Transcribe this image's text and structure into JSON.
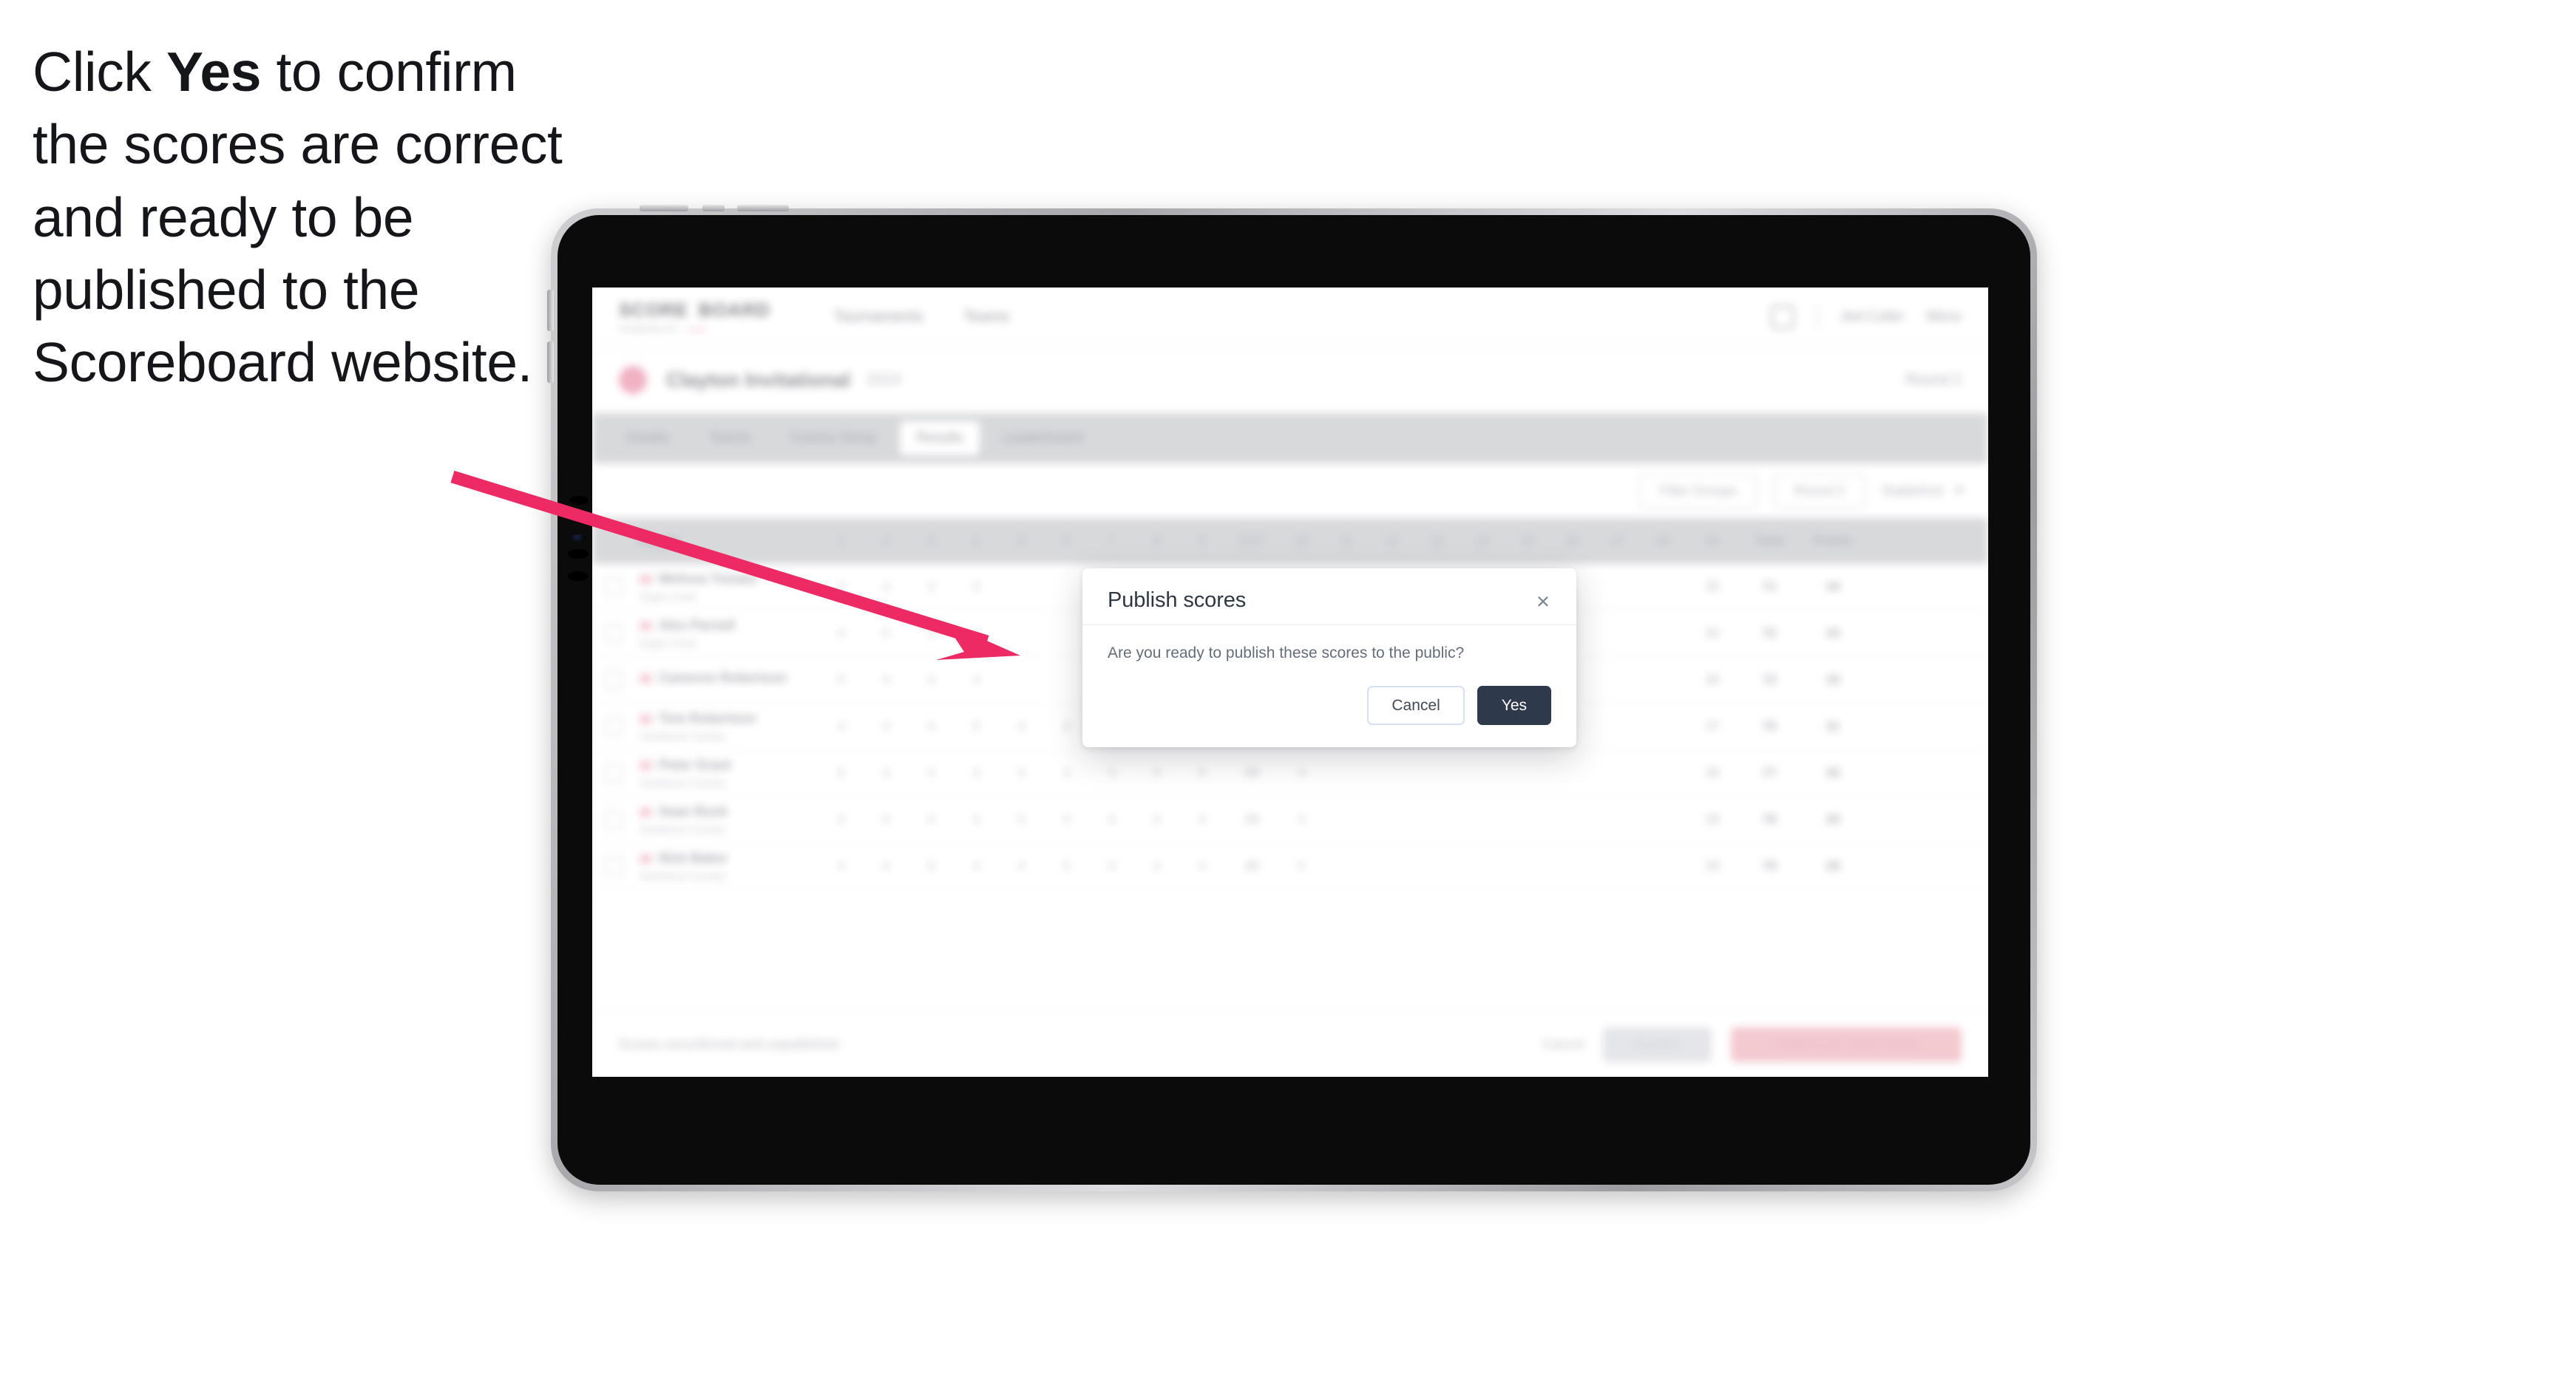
{
  "instruction": {
    "before": "Click ",
    "keyword": "Yes",
    "after": " to confirm the scores are correct and ready to be published to the Scoreboard website."
  },
  "colors": {
    "accent_pink": "#ED2A63",
    "modal_primary": "#2e3a4c",
    "device_frame": "#0b0b0c"
  },
  "annotation": {
    "arrow_name": "pointer-arrow",
    "points_to": "Yes"
  },
  "modal": {
    "title": "Publish scores",
    "close_glyph": "×",
    "message": "Are you ready to publish these scores to the public?",
    "cancel_label": "Cancel",
    "confirm_label": "Yes"
  },
  "app": {
    "brand": {
      "word1": "SCORE",
      "word2": "BOARD",
      "sub": "POWERED BY",
      "chip": ""
    },
    "topnav": [
      "Tournaments",
      "Teams"
    ],
    "topbar": {
      "icon": "bell-icon",
      "link1": "Jed Cutler",
      "link2": "Menu"
    },
    "tournament": {
      "title": "Clayton Invitational",
      "subtitle": "2024",
      "right_label": "Round 2"
    },
    "tabs": [
      {
        "label": "Details"
      },
      {
        "label": "Teams"
      },
      {
        "label": "Course Setup"
      },
      {
        "label": "Results"
      },
      {
        "label": "Leaderboard"
      }
    ],
    "active_tab_index": 3,
    "filters": {
      "left_label": "",
      "pill1": "Filter Groups",
      "pill2": "Round 2",
      "pill3": "Stableford"
    },
    "table": {
      "headers": {
        "player": "Player",
        "holes": [
          "1",
          "2",
          "3",
          "4",
          "5",
          "6",
          "7",
          "8",
          "9",
          "10",
          "11",
          "12",
          "13",
          "14",
          "15",
          "16",
          "17",
          "18"
        ],
        "out": "OUT",
        "in": "IN",
        "total": "Total",
        "points": "Points"
      },
      "rows": [
        {
          "name": "Melissa Tomato",
          "club": "Eagle Creek",
          "holes": [
            "4",
            "4",
            "3",
            "5",
            "",
            "",
            "",
            "",
            "",
            "",
            "",
            "",
            "",
            "",
            "",
            "",
            "",
            ""
          ],
          "out": "36",
          "in": "35",
          "total": "71",
          "points": "34"
        },
        {
          "name": "Alex Parnell",
          "club": "Eagle Creek",
          "holes": [
            "4",
            "5",
            "4",
            "4",
            "",
            "",
            "",
            "",
            "",
            "",
            "",
            "",
            "",
            "",
            "",
            "",
            "",
            ""
          ],
          "out": "38",
          "in": "34",
          "total": "72",
          "points": "33"
        },
        {
          "name": "Cameron Robertson",
          "club": "",
          "holes": [
            "5",
            "4",
            "3",
            "4",
            "",
            "",
            "",
            "",
            "",
            "",
            "",
            "",
            "",
            "",
            "",
            "",
            "",
            ""
          ],
          "out": "36",
          "in": "36",
          "total": "72",
          "points": "33"
        },
        {
          "name": "Tom Robertson",
          "club": "Sandhurst Country",
          "holes": [
            "4",
            "4",
            "4",
            "5",
            "4",
            "3",
            "4",
            "5",
            "4",
            "4",
            "",
            "",
            "",
            "",
            "",
            "",
            "",
            ""
          ],
          "out": "38",
          "in": "37",
          "total": "75",
          "points": "31"
        },
        {
          "name": "Peter Grant",
          "club": "Sandhurst Country",
          "holes": [
            "5",
            "4",
            "4",
            "4",
            "4",
            "4",
            "3",
            "4",
            "5",
            "4",
            "",
            "",
            "",
            "",
            "",
            "",
            "",
            ""
          ],
          "out": "39",
          "in": "38",
          "total": "77",
          "points": "30"
        },
        {
          "name": "Sean Rush",
          "club": "Sandhurst Country",
          "holes": [
            "4",
            "5",
            "4",
            "4",
            "5",
            "4",
            "4",
            "4",
            "4",
            "4",
            "",
            "",
            "",
            "",
            "",
            "",
            "",
            ""
          ],
          "out": "39",
          "in": "39",
          "total": "78",
          "points": "29"
        },
        {
          "name": "Nick Baker",
          "club": "Sandhurst Country",
          "holes": [
            "4",
            "4",
            "5",
            "4",
            "4",
            "5",
            "4",
            "4",
            "4",
            "5",
            "",
            "",
            "",
            "",
            "",
            "",
            "",
            ""
          ],
          "out": "40",
          "in": "39",
          "total": "79",
          "points": "28"
        }
      ]
    },
    "footer": {
      "note": "Scores unconfirmed and unpublished",
      "link": "Cancel",
      "secondary": "Confirm",
      "primary": "Publish and send results"
    }
  }
}
